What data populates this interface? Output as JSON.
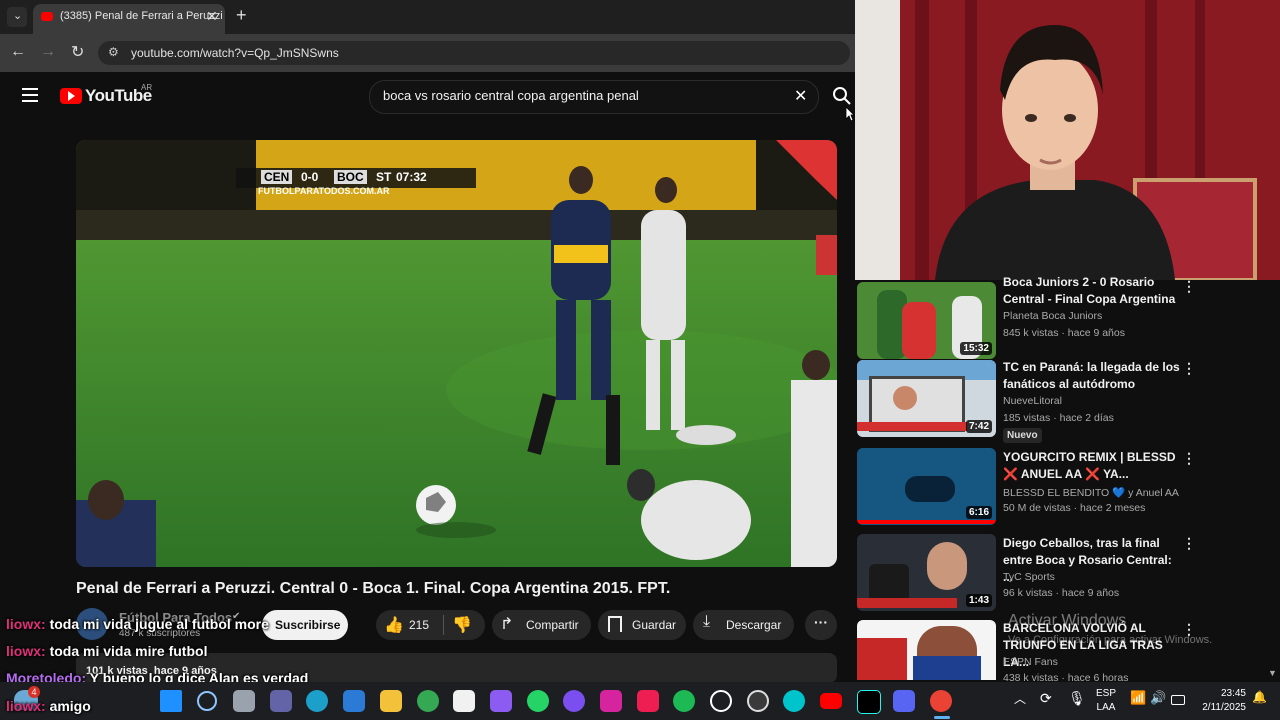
{
  "browser": {
    "tab_title": "(3385) Penal de Ferrari a Peruzzi",
    "url": "youtube.com/watch?v=Qp_JmSNSwns"
  },
  "youtube": {
    "logo_text": "YouTube",
    "region": "AR",
    "search_query": "boca vs rosario central copa argentina penal",
    "video": {
      "score_team1": "CEN",
      "score": "0-0",
      "score_team2": "BOC",
      "period": "ST",
      "clock": "07:32",
      "watermark": "FUTBOLPARATODOS.COM.AR",
      "title": "Penal de Ferrari a Peruzzi. Central 0 - Boca 1. Final. Copa Argentina 2015. FPT.",
      "channel": "Fútbol Para Todos",
      "subscribers": "487 k suscriptores",
      "subscribe_label": "Suscribirse",
      "likes": "215",
      "share_label": "Compartir",
      "save_label": "Guardar",
      "download_label": "Descargar",
      "views_date": "101 k vistas  hace 9 años"
    },
    "recommended": [
      {
        "title": "Boca Juniors 2 - 0 Rosario Central - Final Copa Argentina ...",
        "channel": "Planeta Boca Juniors",
        "meta": "845 k vistas · hace 9 años",
        "duration": "15:32"
      },
      {
        "title": "TC en Paraná: la llegada de los fanáticos al autódromo",
        "channel": "NueveLitoral",
        "meta": "185 vistas · hace 2 días",
        "duration": "7:42",
        "badge": "Nuevo"
      },
      {
        "title": "YOGURCITO REMIX | BLESSD ❌ ANUEL AA ❌ YA...",
        "channel": "BLESSD EL BENDITO 💙 y Anuel AA",
        "meta": "50 M de vistas · hace 2 meses",
        "duration": "6:16"
      },
      {
        "title": "Diego Ceballos, tras la final entre Boca y Rosario Central: ...",
        "channel": "TyC Sports",
        "meta": "96 k vistas · hace 9 años",
        "duration": "1:43"
      },
      {
        "title": "BARCELONA VOLVIÓ AL TRIUNFO EN LA LIGA TRAS LA...",
        "channel": "ESPN Fans",
        "meta": "438 k vistas · hace 6 horas",
        "duration": ""
      }
    ]
  },
  "chat": [
    {
      "user": "liowx:",
      "message": "toda mi vida jugue al futbol more",
      "color": "#e0307a"
    },
    {
      "user": "liowx:",
      "message": "toda mi vida mire futbol",
      "color": "#e0307a"
    },
    {
      "user": "Moretoledo:",
      "message": "Y bueno lo q dice Alan es verdad",
      "color": "#b56cf0"
    },
    {
      "user": "liowx:",
      "message": "amigo",
      "color": "#e0307a"
    }
  ],
  "windows_watermark": {
    "line1": "Activar Windows",
    "line2": "Ve a Configuración para activar Windows."
  },
  "taskbar": {
    "notification_count": "4",
    "language": "ESP",
    "layout": "LAA",
    "time": "23:45",
    "date": "2/11/2025"
  },
  "colors": {
    "youtube_red": "#ff0000",
    "pitch_green": "#3f8a2e",
    "chat_pink": "#e0307a",
    "chat_purple": "#b56cf0"
  }
}
